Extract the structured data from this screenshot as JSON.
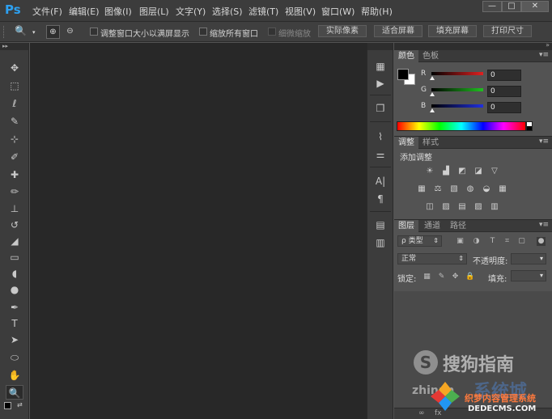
{
  "app": {
    "logo": "Ps"
  },
  "menu": [
    "文件(F)",
    "编辑(E)",
    "图像(I)",
    "图层(L)",
    "文字(Y)",
    "选择(S)",
    "滤镜(T)",
    "视图(V)",
    "窗口(W)",
    "帮助(H)"
  ],
  "window_controls": {
    "minimize": "—",
    "restore": "□",
    "close": "✕"
  },
  "options_bar": {
    "check_resize_window": "调整窗口大小以满屏显示",
    "check_zoom_all": "缩放所有窗口",
    "check_scrubby": "细微缩放",
    "btn_actual_pixels": "实际像素",
    "btn_fit_screen": "适合屏幕",
    "btn_fill_screen": "填充屏幕",
    "btn_print_size": "打印尺寸"
  },
  "color_panel": {
    "tabs": [
      "颜色",
      "色板"
    ],
    "channels": [
      {
        "label": "R",
        "value": "0",
        "color": "#e02020"
      },
      {
        "label": "G",
        "value": "0",
        "color": "#20c020"
      },
      {
        "label": "B",
        "value": "0",
        "color": "#2030e0"
      }
    ]
  },
  "adjustments_panel": {
    "tabs": [
      "调整",
      "样式"
    ],
    "add_label": "添加调整",
    "icons_row1": [
      "☀",
      "▟",
      "◩",
      "◪",
      "▽"
    ],
    "icons_row2": [
      "▦",
      "⚖",
      "▧",
      "◍",
      "◒",
      "▦"
    ],
    "icons_row3": [
      "◫",
      "▨",
      "▤",
      "▨",
      "▥"
    ]
  },
  "layers_panel": {
    "tabs": [
      "图层",
      "通道",
      "路径"
    ],
    "kind_filter": "ρ 类型",
    "blend_mode": "正常",
    "opacity_label": "不透明度:",
    "lock_label": "锁定:",
    "fill_label": "填充:"
  },
  "watermark": {
    "sogou_s": "S",
    "sogou_text": "搜狗指南",
    "zhinan": "zhinan",
    "xtc": "系统城",
    "site": "织梦内容管理系统",
    "url": "DEDECMS.COM"
  }
}
